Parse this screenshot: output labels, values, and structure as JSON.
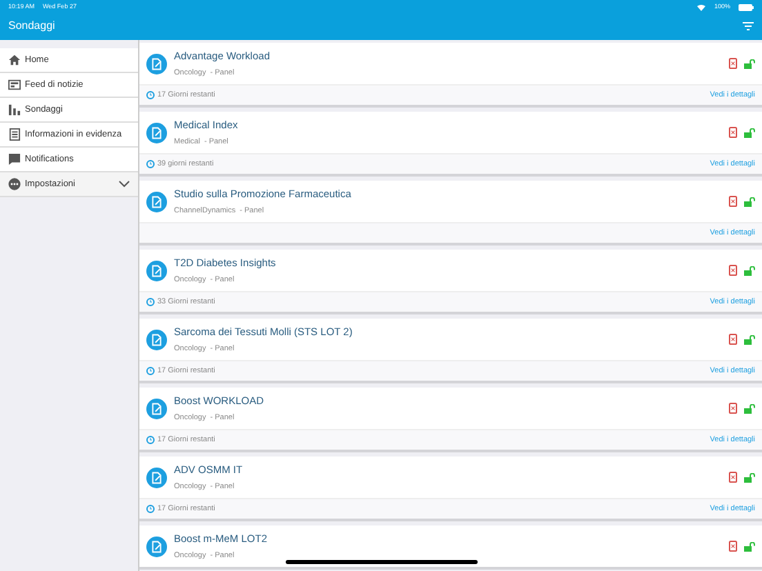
{
  "status_bar": {
    "time": "10:19 AM",
    "date": "Wed Feb 27",
    "battery": "100%"
  },
  "header": {
    "title": "Sondaggi"
  },
  "sidebar": {
    "items": [
      {
        "label": "Home",
        "expandable": false
      },
      {
        "label": "Feed di notizie",
        "expandable": false
      },
      {
        "label": "Sondaggi",
        "expandable": false
      },
      {
        "label": "Informazioni in evidenza",
        "expandable": false
      },
      {
        "label": "Notifications",
        "expandable": false
      },
      {
        "label": "Impostazioni",
        "expandable": true
      }
    ]
  },
  "surveys": [
    {
      "title": "Advantage Workload",
      "category": "Oncology",
      "type": "- Panel",
      "remaining": "17 Giorni restanti",
      "details": "Vedi i dettagli"
    },
    {
      "title": "Medical Index",
      "category": "Medical",
      "type": "- Panel",
      "remaining": "39 giorni restanti",
      "details": "Vedi i dettagli"
    },
    {
      "title": "Studio sulla Promozione Farmaceutica",
      "category": "ChannelDynamics",
      "type": "- Panel",
      "details": "Vedi i dettagli"
    },
    {
      "title": "T2D Diabetes Insights",
      "category": "Oncology",
      "type": "- Panel",
      "remaining": "33 Giorni restanti",
      "details": "Vedi i dettagli"
    },
    {
      "title": "Sarcoma dei Tessuti Molli (STS LOT 2)",
      "category": "Oncology",
      "type": "- Panel",
      "remaining": "17 Giorni restanti",
      "details": "Vedi i dettagli"
    },
    {
      "title": "Boost WORKLOAD",
      "category": "Oncology",
      "type": "- Panel",
      "remaining": "17 Giorni restanti",
      "details": "Vedi i dettagli"
    },
    {
      "title": "ADV OSMM IT",
      "category": "Oncology",
      "type": "- Panel",
      "remaining": "17 Giorni restanti",
      "details": "Vedi i dettagli"
    },
    {
      "title": "Boost m-MeM LOT2",
      "category": "Oncology",
      "type": "- Panel"
    }
  ]
}
